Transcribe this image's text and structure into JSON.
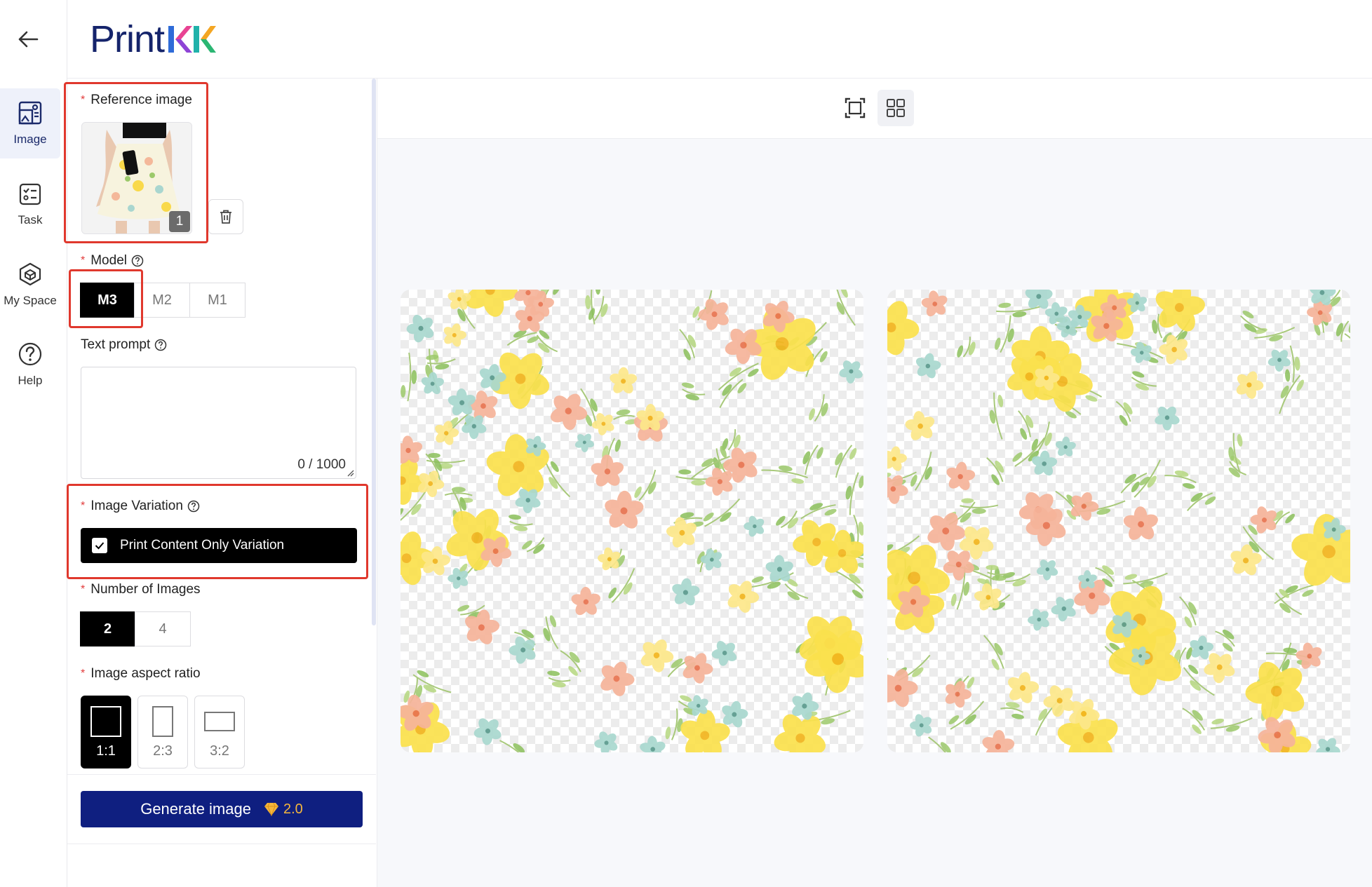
{
  "brand": {
    "name": "Print",
    "accent": "#15246b"
  },
  "rail": {
    "back_icon": "arrow-left-icon",
    "items": [
      {
        "label": "Image",
        "icon": "image-gallery-icon",
        "active": true
      },
      {
        "label": "Task",
        "icon": "task-list-icon",
        "active": false
      },
      {
        "label": "My Space",
        "icon": "cube-icon",
        "active": false
      },
      {
        "label": "Help",
        "icon": "help-circle-icon",
        "active": false
      }
    ]
  },
  "form": {
    "reference": {
      "label": "Reference image",
      "count": "1"
    },
    "model": {
      "label": "Model",
      "options": [
        "M3",
        "M2",
        "M1"
      ],
      "selected": "M3"
    },
    "prompt": {
      "label": "Text prompt",
      "value": "",
      "counter": "0 / 1000"
    },
    "variation": {
      "label": "Image Variation",
      "option": "Print Content Only Variation",
      "checked": true
    },
    "count": {
      "label": "Number of Images",
      "options": [
        "2",
        "4"
      ],
      "selected": "2"
    },
    "ratio": {
      "label": "Image aspect ratio",
      "options": [
        "1:1",
        "2:3",
        "3:2"
      ],
      "selected": "1:1"
    },
    "generate": {
      "label": "Generate image",
      "cost": "2.0"
    }
  },
  "toolbar": {
    "icons": [
      "frame-expand-icon",
      "grid-view-icon"
    ]
  },
  "results": [
    {
      "name": "floral-pattern-1"
    },
    {
      "name": "floral-pattern-2"
    }
  ]
}
